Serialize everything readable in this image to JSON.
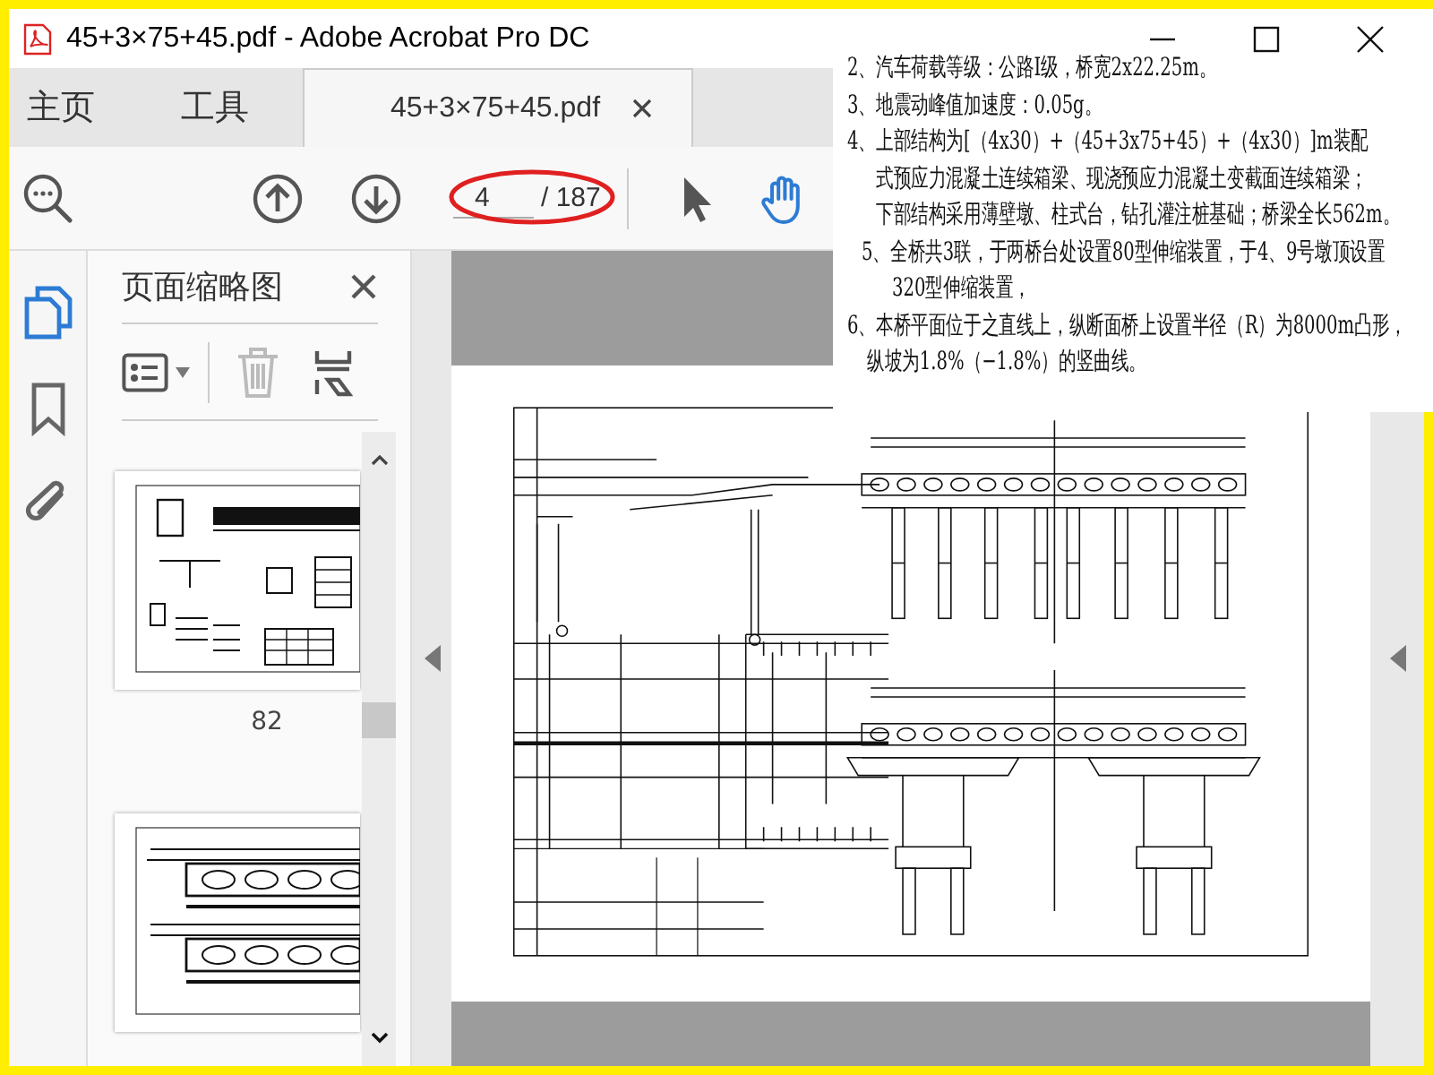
{
  "window": {
    "title": "45+3×75+45.pdf - Adobe Acrobat Pro DC"
  },
  "tabs": [
    {
      "kind": "nav",
      "label": "主页",
      "selected": false
    },
    {
      "kind": "nav",
      "label": "工具",
      "selected": false
    },
    {
      "kind": "document",
      "label": "45+3×75+45.pdf",
      "selected": true
    }
  ],
  "toolbar": {
    "page_number": "4",
    "page_total": "/ 187",
    "tools": [
      {
        "kind": "select",
        "selected": false
      },
      {
        "kind": "hand",
        "selected": true
      }
    ]
  },
  "sidebar": {
    "rail": [
      {
        "kind": "pages",
        "selected": true
      },
      {
        "kind": "bookmarks",
        "selected": false
      },
      {
        "kind": "attachments",
        "selected": false
      }
    ],
    "title": "页面缩略图",
    "thumbnails": [
      {
        "kind": "detail",
        "label": "82"
      },
      {
        "kind": "sections"
      }
    ]
  },
  "notes": [
    {
      "kind": "item",
      "text": "2、汽车荷载等级：公路Ⅰ级，桥宽2x22.25m。"
    },
    {
      "kind": "item",
      "text": "3、地震动峰值加速度：0.05g。"
    },
    {
      "kind": "item",
      "text": "4、上部结构为[（4x30）+（45+3x75+45）+（4x30）]m装配"
    },
    {
      "kind": "cont",
      "text": "式预应力混凝土连续箱梁、现浇预应力混凝土变截面连续箱梁；"
    },
    {
      "kind": "cont",
      "text": "下部结构采用薄壁墩、柱式台，钻孔灌注桩基础；桥梁全长562m。"
    },
    {
      "kind": "sub",
      "text": "5、全桥共3联，于两桥台处设置80型伸缩装置，于4、9号墩顶设置"
    },
    {
      "kind": "subcont",
      "text": "320型伸缩装置，"
    },
    {
      "kind": "item",
      "text": "6、本桥平面位于之直线上，纵断面桥上设置半径（R）为8000m凸形，"
    },
    {
      "kind": "cont2",
      "text": "纵坡为1.8%（−1.8%）的竖曲线。"
    }
  ]
}
